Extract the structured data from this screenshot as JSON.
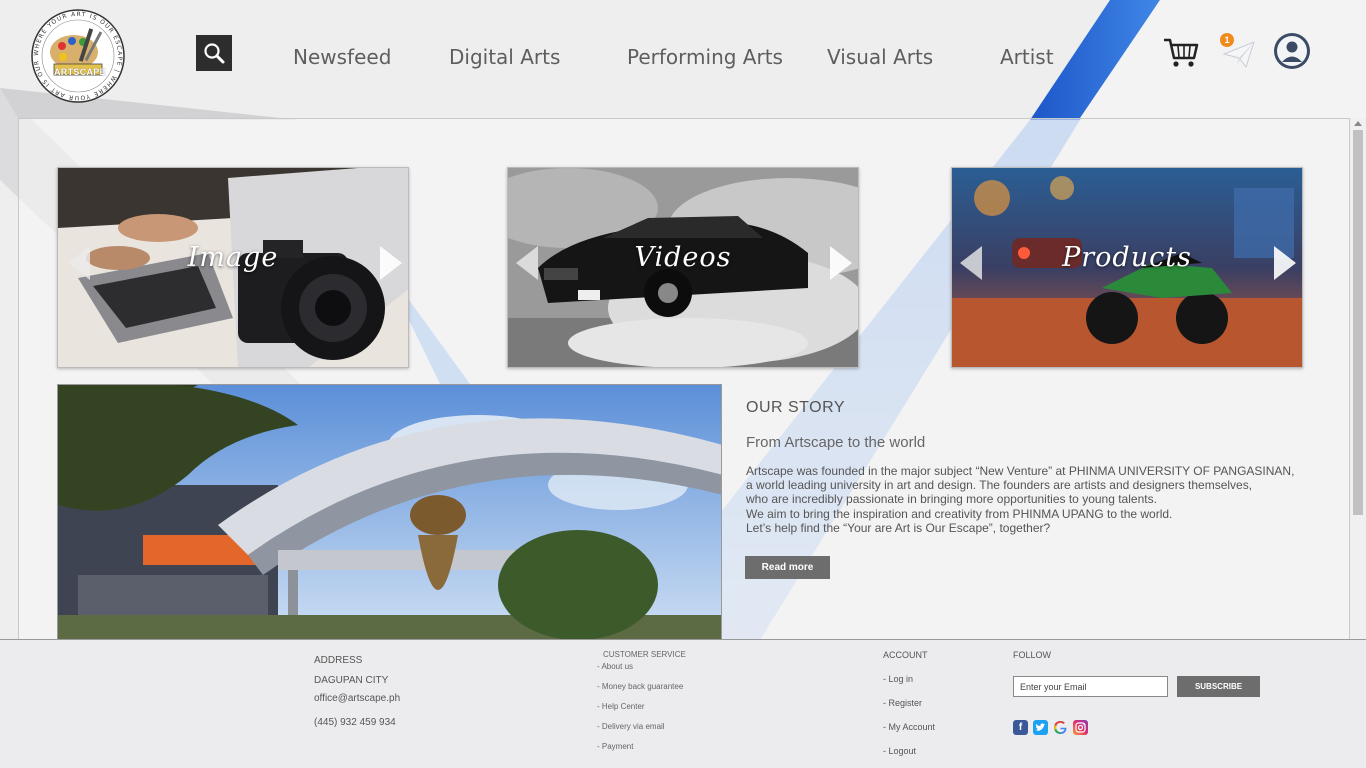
{
  "brand": {
    "logo_text": "ARTSCAPE",
    "logo_ring_text": "WHERE YOUR ART IS OUR ESCAPE"
  },
  "nav": {
    "items": [
      {
        "label": "Newsfeed"
      },
      {
        "label": "Digital Arts"
      },
      {
        "label": "Performing Arts"
      },
      {
        "label": "Visual Arts"
      },
      {
        "label": "Artist"
      }
    ],
    "notification_count": "1"
  },
  "cards": [
    {
      "label": "Image"
    },
    {
      "label": "Videos"
    },
    {
      "label": "Products"
    }
  ],
  "story": {
    "title": "OUR STORY",
    "subtitle": "From Artscape to the world",
    "lines": [
      "Artscape was founded in the major subject “New Venture” at PHINMA UNIVERSITY OF PANGASINAN,",
      "a world leading university in art and design. The founders are artists and designers themselves,",
      "who are incredibly passionate in bringing more opportunities to young talents.",
      "We aim to bring the inspiration and creativity from PHINMA UPANG  to the world.",
      "Let’s help find the “Your are Art is Our Escape”, together?"
    ],
    "button": "Read more"
  },
  "footer": {
    "address": {
      "heading": "ADDRESS",
      "city": "DAGUPAN CITY",
      "email": "office@artscape.ph",
      "phone": "(445) 932 459 934"
    },
    "customer_service": {
      "heading": "CUSTOMER SERVICE",
      "links": [
        "- About us",
        "- Money back guarantee",
        "- Help Center",
        "- Delivery via email",
        "- Payment"
      ]
    },
    "account": {
      "heading": "ACCOUNT",
      "links": [
        "- Log in",
        "- Register",
        "- My Account",
        "- Logout"
      ]
    },
    "follow": {
      "heading": "FOLLOW",
      "email_placeholder": "Enter your Email",
      "subscribe": "SUBSCRIBE",
      "socials": [
        "facebook-icon",
        "twitter-icon",
        "google-icon",
        "instagram-icon"
      ]
    }
  },
  "colors": {
    "accent_blue": "#2f6fd6",
    "button_gray": "#6d6d6d",
    "badge_orange": "#f08a1c"
  }
}
